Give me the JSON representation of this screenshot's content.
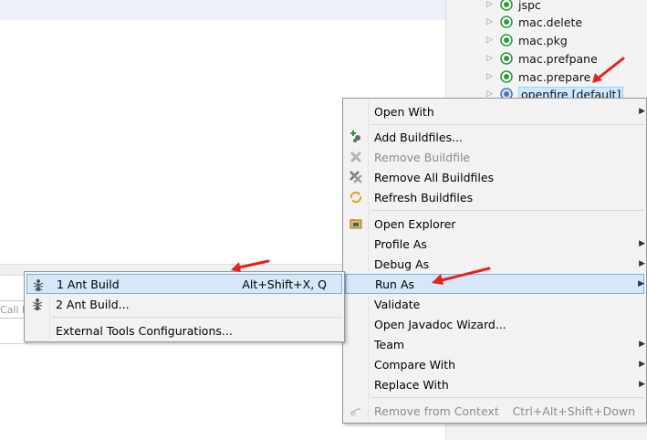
{
  "project_tree": {
    "items": [
      {
        "label": "jspc",
        "selected": false
      },
      {
        "label": "mac.delete",
        "selected": false
      },
      {
        "label": "mac.pkg",
        "selected": false
      },
      {
        "label": "mac.prefpane",
        "selected": false
      },
      {
        "label": "mac.prepare",
        "selected": false
      },
      {
        "label": "openfire [default]",
        "selected": true
      }
    ]
  },
  "console": {
    "input_text": "Call H"
  },
  "context_menu": {
    "open_with": "Open With",
    "add_buildfiles": "Add Buildfiles...",
    "remove_buildfile": "Remove Buildfile",
    "remove_all_buildfiles": "Remove All Buildfiles",
    "refresh_buildfiles": "Refresh Buildfiles",
    "open_explorer": "Open Explorer",
    "profile_as": "Profile As",
    "debug_as": "Debug As",
    "run_as": "Run As",
    "validate": "Validate",
    "open_javadoc_wizard": "Open Javadoc Wizard...",
    "team": "Team",
    "compare_with": "Compare With",
    "replace_with": "Replace With",
    "remove_from_context": "Remove from Context",
    "remove_from_context_accel": "Ctrl+Alt+Shift+Down"
  },
  "run_as_submenu": {
    "ant_build": "1 Ant Build",
    "ant_build_accel": "Alt+Shift+X, Q",
    "ant_build_dialog": "2 Ant Build...",
    "external_tools": "External Tools Configurations..."
  },
  "colors": {
    "highlight": "#d5e7f8",
    "annotation_arrow": "#e8201c",
    "target_icon": "#2e9b3f"
  }
}
